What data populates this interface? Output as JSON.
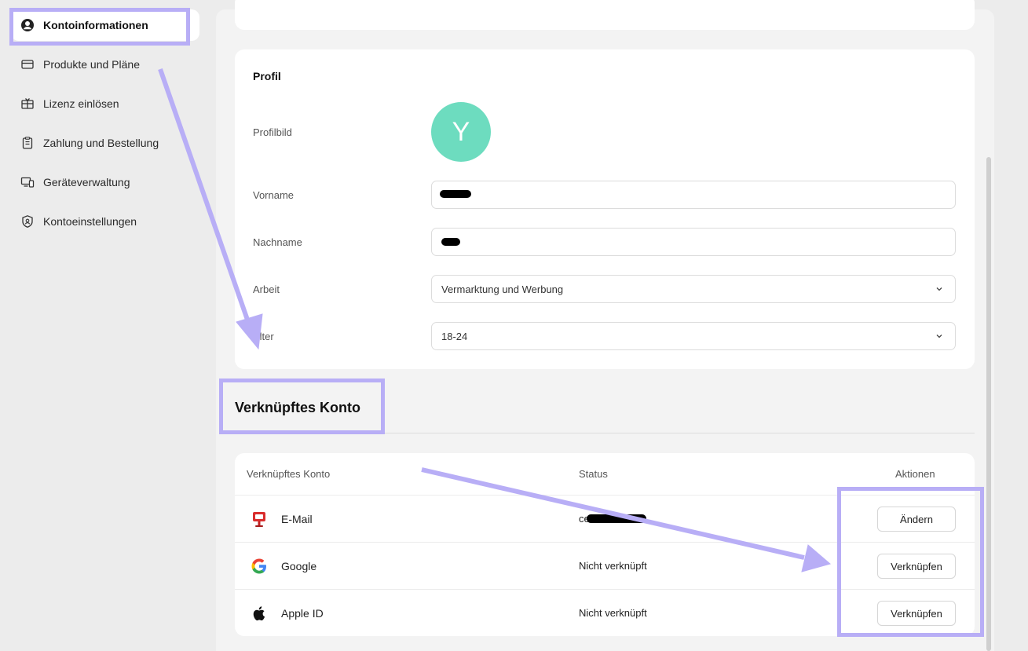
{
  "sidebar": {
    "items": [
      {
        "label": "Kontoinformationen",
        "icon": "user-circle-icon",
        "active": true
      },
      {
        "label": "Produkte und Pläne",
        "icon": "credit-card-icon",
        "active": false
      },
      {
        "label": "Lizenz einlösen",
        "icon": "gift-icon",
        "active": false
      },
      {
        "label": "Zahlung und Bestellung",
        "icon": "clipboard-icon",
        "active": false
      },
      {
        "label": "Geräteverwaltung",
        "icon": "devices-icon",
        "active": false
      },
      {
        "label": "Kontoeinstellungen",
        "icon": "shield-icon",
        "active": false
      }
    ]
  },
  "profile": {
    "title": "Profil",
    "avatar_label": "Profilbild",
    "avatar_initial": "Y",
    "avatar_color": "#6ddcbf",
    "first_name_label": "Vorname",
    "last_name_label": "Nachname",
    "job_label": "Arbeit",
    "job_value": "Vermarktung und Werbung",
    "age_label": "Alter",
    "age_value": "18-24"
  },
  "linked": {
    "section_title": "Verknüpftes Konto",
    "col_account": "Verknüpftes Konto",
    "col_status": "Status",
    "col_actions": "Aktionen",
    "rows": [
      {
        "name": "E-Mail",
        "icon": "mailbox-icon",
        "status": "ce",
        "action": "Ändern"
      },
      {
        "name": "Google",
        "icon": "google-icon",
        "status": "Nicht verknüpft",
        "action": "Verknüpfen"
      },
      {
        "name": "Apple ID",
        "icon": "apple-icon",
        "status": "Nicht verknüpft",
        "action": "Verknüpfen"
      }
    ]
  },
  "colors": {
    "annotation": "#b8aef6",
    "avatar": "#6ddcbf"
  }
}
